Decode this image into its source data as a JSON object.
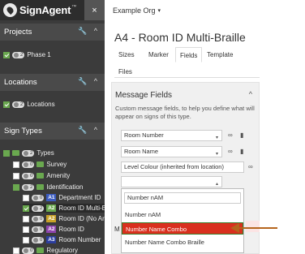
{
  "brand": {
    "name": "SignAgent",
    "tm": "™",
    "close": "×"
  },
  "topbar": {
    "org": "Example Org",
    "caret": "▾"
  },
  "sidebar": {
    "tools": "🔧 ^",
    "projects": {
      "heading": "Projects",
      "item": {
        "count": "2",
        "label": "Phase 1"
      }
    },
    "locations": {
      "heading": "Locations",
      "item": {
        "count": "2",
        "label": "Locations"
      }
    },
    "signtypes": {
      "heading": "Sign Types",
      "items": [
        {
          "count": "2",
          "label": "Types"
        },
        {
          "count": "0",
          "label": "Survey"
        },
        {
          "count": "0",
          "label": "Amenity"
        },
        {
          "count": "2",
          "label": "Identification"
        },
        {
          "count": "0",
          "tag": "A1",
          "label": "Department ID"
        },
        {
          "count": "2",
          "tag": "A2",
          "label": "Room ID Multi-Bra"
        },
        {
          "count": "0",
          "tag": "A2",
          "label": "Room ID (No Art"
        },
        {
          "count": "0",
          "tag": "A2",
          "label": "Room ID"
        },
        {
          "count": "0",
          "tag": "A3",
          "label": "Room Number"
        },
        {
          "count": "0",
          "label": "Regulatory"
        }
      ]
    }
  },
  "main": {
    "title": "A4 - Room ID Multi-Braille",
    "tabs": [
      "Sizes",
      "Marker",
      "Fields",
      "Template",
      "Files"
    ],
    "active_tab": "Fields",
    "panel": {
      "title": "Message Fields",
      "desc": "Custom message fields, to help you define what will appear on signs of this type.",
      "fields": [
        "Room Number",
        "Room Name",
        "Level Colour (inherited from location)"
      ],
      "partial_label": "M"
    },
    "dropdown": {
      "search": "Number nAM",
      "options": [
        "Number nAM",
        "Number Name Combo",
        "Number Name Combo Braille"
      ],
      "highlighted": 1
    }
  },
  "colors": {
    "accent": "#6aa84f",
    "highlight": "#d9301e",
    "arrow": "#b5651d"
  },
  "icons": {
    "link": "link-icon",
    "trash": "trash-icon",
    "wrench": "wrench-icon"
  }
}
